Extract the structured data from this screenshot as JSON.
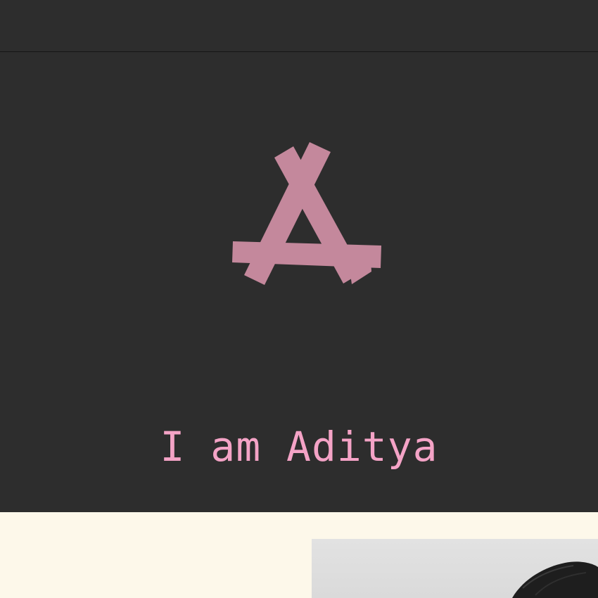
{
  "header": {},
  "hero": {
    "logo_icon": "stacked-strips-a-monogram-icon",
    "logo_color": "#c4889c",
    "headline": "I am Aditya",
    "headline_color": "#f4a3c6",
    "background": "#2d2d2d"
  },
  "about": {
    "background": "#fdf8ea",
    "photo_subject": "portrait-photo"
  }
}
